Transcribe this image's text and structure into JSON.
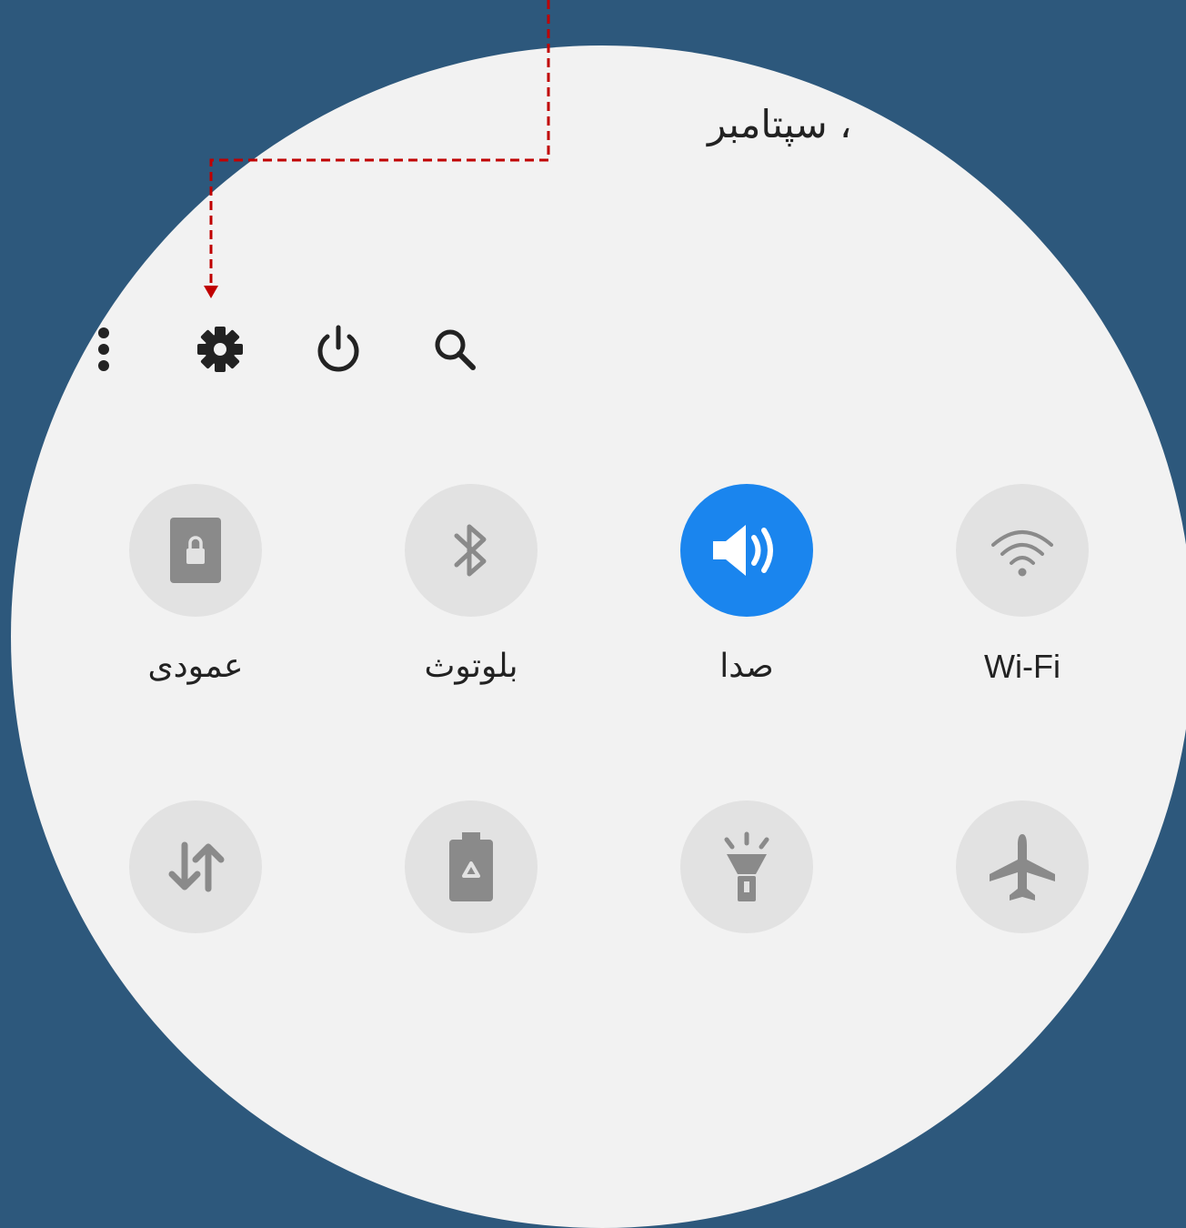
{
  "header": {
    "date_text": "، سپتامبر"
  },
  "toolbar": {
    "icons": [
      "more-options-icon",
      "settings-gear-icon",
      "power-icon",
      "search-icon"
    ]
  },
  "quick_tiles": {
    "row1": [
      {
        "label": "عمودی",
        "icon": "screen-lock-rotation-icon",
        "active": false
      },
      {
        "label": "بلوتوث",
        "icon": "bluetooth-icon",
        "active": false
      },
      {
        "label": "صدا",
        "icon": "sound-icon",
        "active": true
      },
      {
        "label": "Wi-Fi",
        "icon": "wifi-icon",
        "active": false
      }
    ],
    "row2": [
      {
        "icon": "mobile-data-icon",
        "active": false
      },
      {
        "icon": "power-saving-icon",
        "active": false
      },
      {
        "icon": "flashlight-icon",
        "active": false
      },
      {
        "icon": "airplane-mode-icon",
        "active": false
      }
    ]
  },
  "colors": {
    "background": "#2d587c",
    "panel": "#f2f2f2",
    "tile_inactive": "#e2e2e2",
    "tile_active": "#1a85ee",
    "pointer": "#c00000"
  }
}
